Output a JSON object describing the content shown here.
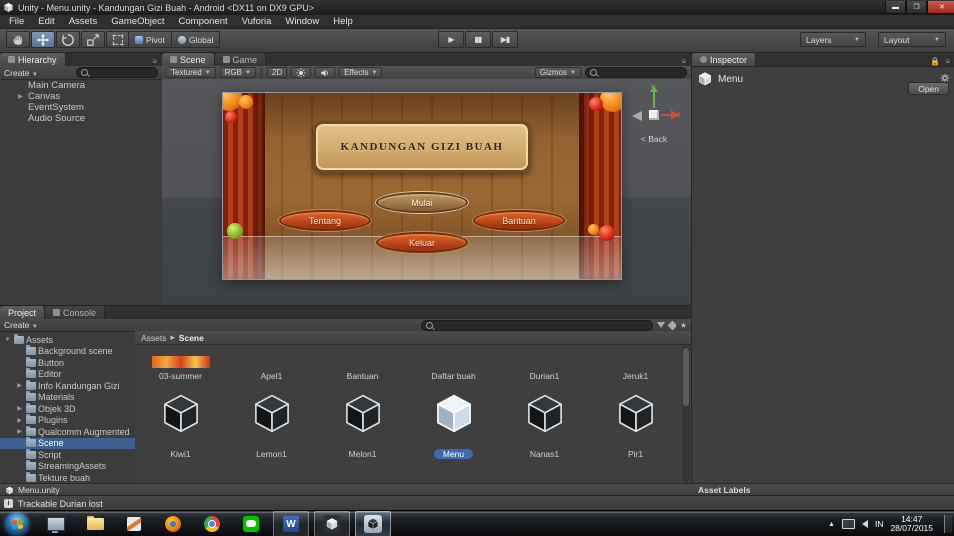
{
  "window": {
    "title": "Unity - Menu.unity - Kandungan Gizi Buah - Android <DX11 on DX9 GPU>",
    "menus": [
      "File",
      "Edit",
      "Assets",
      "GameObject",
      "Component",
      "Vuforia",
      "Window",
      "Help"
    ]
  },
  "toolbar": {
    "pivot": "Pivot",
    "global": "Global",
    "layers": "Layers",
    "layout": "Layout"
  },
  "hierarchy": {
    "tab": "Hierarchy",
    "create": "Create",
    "items": [
      "Main Camera",
      "Canvas",
      "EventSystem",
      "Audio Source"
    ]
  },
  "scene": {
    "tab_scene": "Scene",
    "tab_game": "Game",
    "toolbar": {
      "shading": "Textured",
      "channels": "RGB",
      "mode2d": "2D",
      "effects": "Effects",
      "gizmos": "Gizmos"
    },
    "gizmo": {
      "x": "x",
      "y": "y",
      "view": "< Back"
    },
    "game": {
      "title": "KANDUNGAN GIZI BUAH",
      "buttons": [
        "Mulai",
        "Tentang",
        "Bantuan",
        "Keluar"
      ]
    }
  },
  "inspector": {
    "tab": "Inspector",
    "name": "Menu",
    "open": "Open",
    "asset_labels": "Asset Labels"
  },
  "project": {
    "tab_project": "Project",
    "tab_console": "Console",
    "create": "Create",
    "breadcrumb": {
      "root": "Assets",
      "current": "Scene"
    },
    "tree": [
      "Assets",
      "Background scene",
      "Button",
      "Editor",
      "Info Kandungan Gizi",
      "Materials",
      "Objek 3D",
      "Plugins",
      "Qualcomm Augmented",
      "Scene",
      "Script",
      "StreamingAssets",
      "Tekture buah"
    ],
    "grid_row1": [
      "03-summer",
      "Apel1",
      "Bantuan",
      "Daftar buah",
      "Durian1",
      "Jeruk1"
    ],
    "grid_row2": [
      "Kiwi1",
      "Lemon1",
      "Melon1",
      "Menu",
      "Nanas1",
      "Pir1"
    ],
    "footer": "Menu.unity"
  },
  "status": {
    "message": "Trackable Durian lost"
  },
  "taskbar": {
    "lang": "IN",
    "time": "14:47",
    "date": "28/07/2015"
  }
}
